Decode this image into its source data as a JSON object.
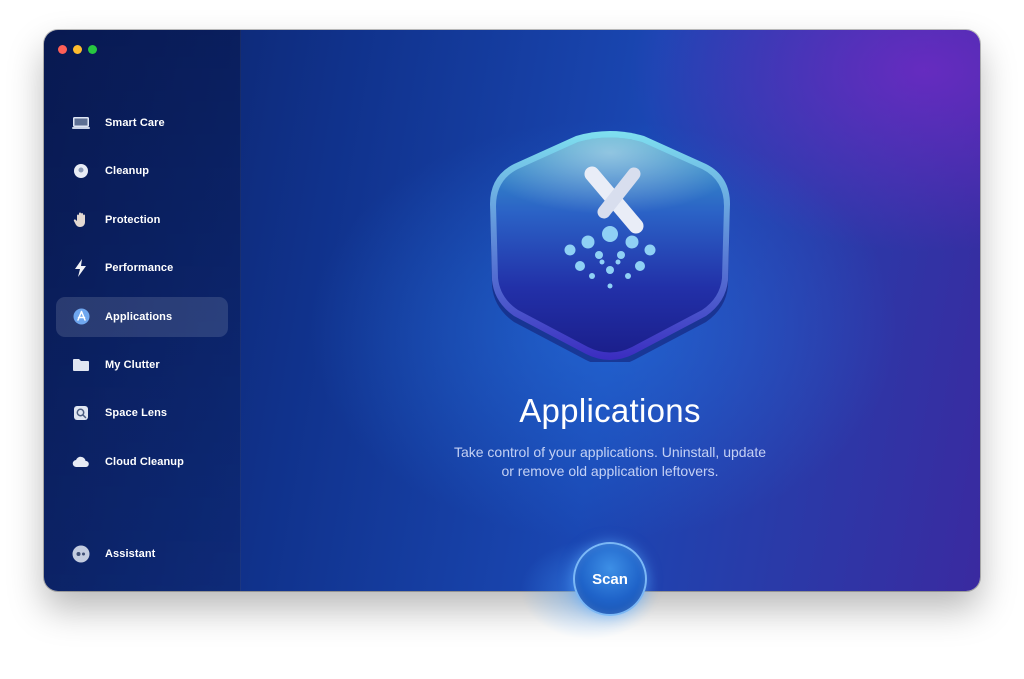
{
  "sidebar": {
    "items": [
      {
        "label": "Smart Care",
        "icon": "display-icon"
      },
      {
        "label": "Cleanup",
        "icon": "cleanup-bubble-icon"
      },
      {
        "label": "Protection",
        "icon": "hand-icon"
      },
      {
        "label": "Performance",
        "icon": "lightning-icon"
      },
      {
        "label": "Applications",
        "icon": "app-store-icon",
        "active": true
      },
      {
        "label": "My Clutter",
        "icon": "folder-icon"
      },
      {
        "label": "Space Lens",
        "icon": "lens-icon"
      },
      {
        "label": "Cloud Cleanup",
        "icon": "cloud-icon"
      }
    ],
    "assistant": {
      "label": "Assistant",
      "icon": "assistant-icon"
    }
  },
  "main": {
    "title": "Applications",
    "subtitle_line1": "Take control of your applications. Uninstall, update",
    "subtitle_line2": "or remove old application leftovers.",
    "scan_label": "Scan"
  },
  "colors": {
    "accent": "#1f63c9",
    "background_start": "#0b1f5e",
    "background_end": "#3a2aa0"
  }
}
